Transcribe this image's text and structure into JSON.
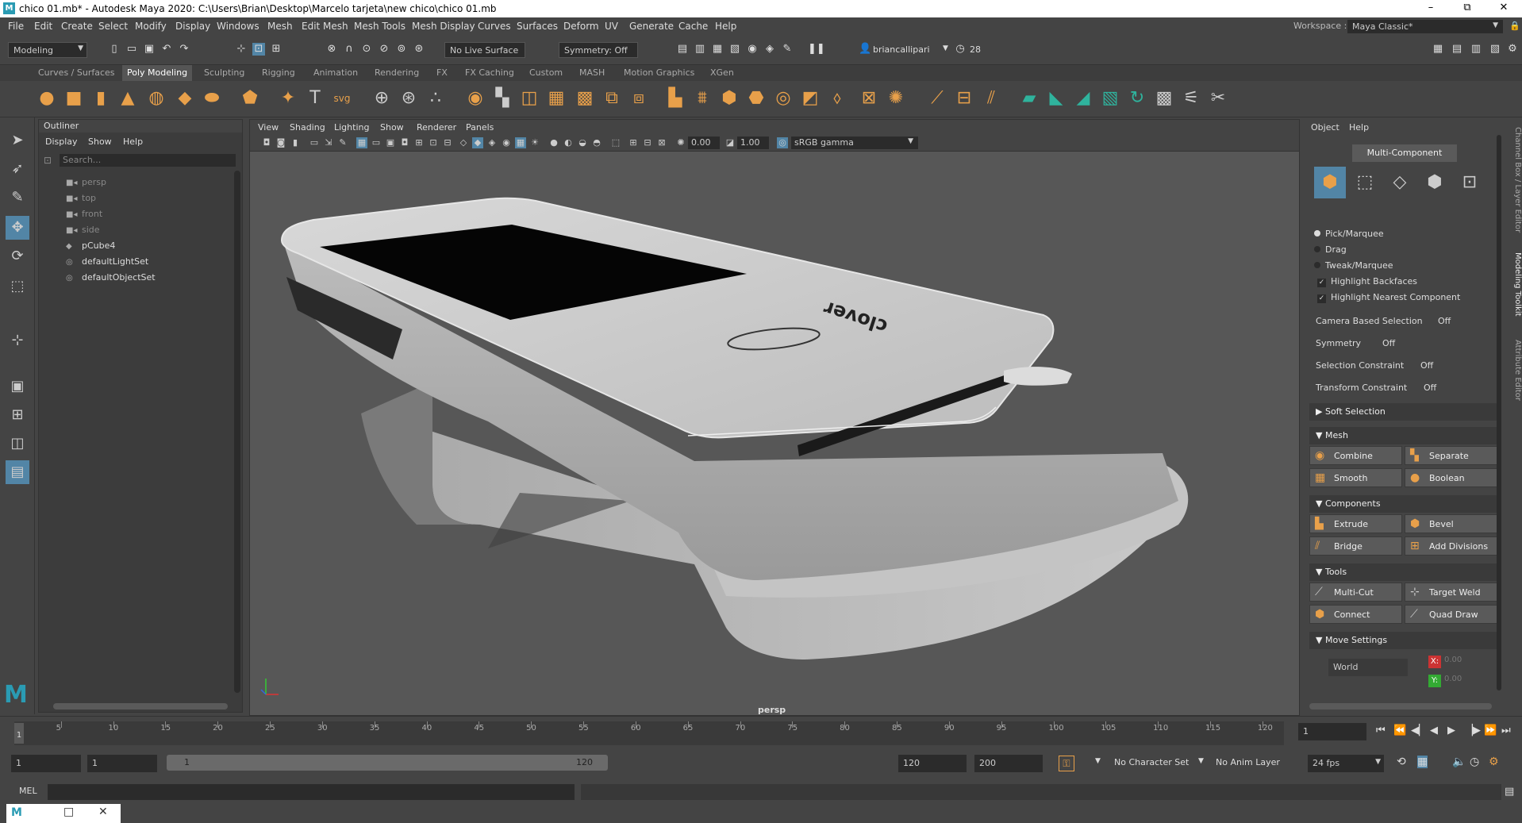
{
  "window": {
    "title": "chico 01.mb* - Autodesk Maya 2020: C:\\Users\\Brian\\Desktop\\Marcelo tarjeta\\new chico\\chico 01.mb",
    "app_icon": "M",
    "minimize": "–",
    "maximize": "⧉",
    "close": "✕"
  },
  "menubar": {
    "items": [
      "File",
      "Edit",
      "Create",
      "Select",
      "Modify",
      "Display",
      "Windows",
      "Mesh",
      "Edit Mesh",
      "Mesh Tools",
      "Mesh Display",
      "Curves",
      "Surfaces",
      "Deform",
      "UV",
      "Generate",
      "Cache",
      "Help"
    ],
    "workspace_label": "Workspace :",
    "workspace_value": "Maya Classic*"
  },
  "statusline": {
    "menuset": "Modeling",
    "live_surface": "No Live Surface",
    "symmetry": "Symmetry: Off",
    "user": "briancallipari",
    "clock_value": "28"
  },
  "shelf": {
    "tabs": [
      "Curves / Surfaces",
      "Poly Modeling",
      "Sculpting",
      "Rigging",
      "Animation",
      "Rendering",
      "FX",
      "FX Caching",
      "Custom",
      "MASH",
      "Motion Graphics",
      "XGen"
    ],
    "active_tab": "Poly Modeling",
    "text_tool": "T",
    "svg_tool": "svg"
  },
  "outliner": {
    "title": "Outliner",
    "menu": [
      "Display",
      "Show",
      "Help"
    ],
    "search_placeholder": "Search...",
    "items": [
      {
        "label": "persp",
        "dim": true
      },
      {
        "label": "top",
        "dim": true
      },
      {
        "label": "front",
        "dim": true
      },
      {
        "label": "side",
        "dim": true
      },
      {
        "label": "pCube4",
        "dim": false
      },
      {
        "label": "defaultLightSet",
        "dim": false
      },
      {
        "label": "defaultObjectSet",
        "dim": false
      }
    ]
  },
  "viewport": {
    "menu": [
      "View",
      "Shading",
      "Lighting",
      "Show",
      "Renderer",
      "Panels"
    ],
    "exposure": "0.00",
    "gamma": "1.00",
    "color_space": "sRGB gamma",
    "camera_label": "persp",
    "model_logo": "clover"
  },
  "modeling_toolkit": {
    "menu": [
      "Object",
      "Help"
    ],
    "multi_component": "Multi-Component",
    "pick_modes": [
      "Pick/Marquee",
      "Drag",
      "Tweak/Marquee"
    ],
    "checks": [
      "Highlight Backfaces",
      "Highlight Nearest Component"
    ],
    "props": [
      {
        "label": "Camera Based Selection",
        "value": "Off"
      },
      {
        "label": "Symmetry",
        "value": "Off"
      },
      {
        "label": "Selection Constraint",
        "value": "Off"
      },
      {
        "label": "Transform Constraint",
        "value": "Off"
      }
    ],
    "soft_selection": "Soft Selection",
    "sections": {
      "mesh": "Mesh",
      "components": "Components",
      "tools": "Tools",
      "move_settings": "Move Settings"
    },
    "mesh_buttons": [
      "Combine",
      "Separate",
      "Smooth",
      "Boolean"
    ],
    "component_buttons": [
      "Extrude",
      "Bevel",
      "Bridge",
      "Add Divisions"
    ],
    "tool_buttons": [
      "Multi-Cut",
      "Target Weld",
      "Connect",
      "Quad Draw"
    ],
    "move_space": "World",
    "axis_x": "X:",
    "axis_y": "Y:",
    "axis_x_value": "0.00",
    "axis_y_value": "0.00",
    "side_tabs": [
      "Channel Box / Layer Editor",
      "Modeling Toolkit",
      "Attribute Editor"
    ]
  },
  "timeline": {
    "ticks": [
      "5",
      "10",
      "15",
      "20",
      "25",
      "30",
      "35",
      "40",
      "45",
      "50",
      "55",
      "60",
      "65",
      "70",
      "75",
      "80",
      "85",
      "90",
      "95",
      "100",
      "105",
      "110",
      "115",
      "120"
    ],
    "start_tick": "1",
    "current_frame": "1"
  },
  "range": {
    "start": "1",
    "playback_start": "1",
    "range_start": "1",
    "range_end": "120",
    "playback_end": "120",
    "end": "200",
    "character_set": "No Character Set",
    "anim_layer": "No Anim Layer",
    "fps": "24 fps"
  },
  "commandline": {
    "language": "MEL"
  }
}
